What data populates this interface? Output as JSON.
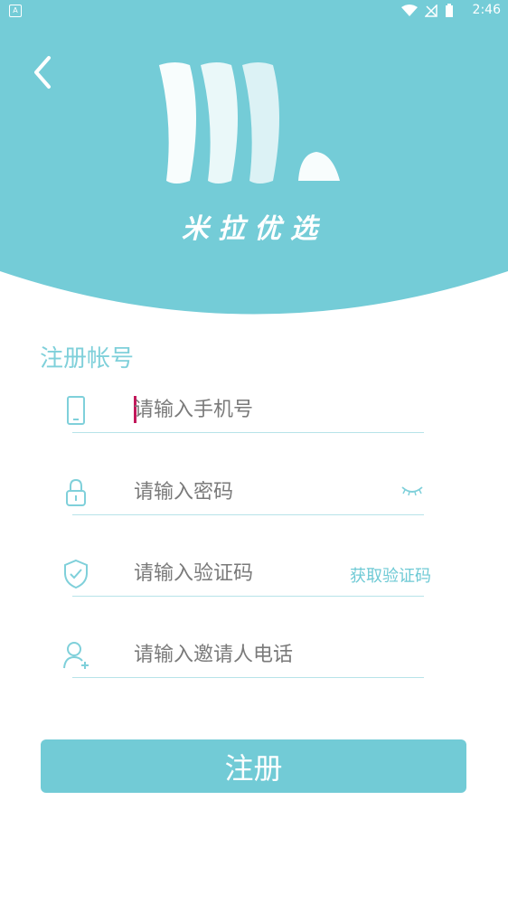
{
  "status_bar": {
    "time": "2:46",
    "notification_badge": "A"
  },
  "header": {
    "brand_name": "米拉优选"
  },
  "form": {
    "title": "注册帐号",
    "phone_placeholder": "请输入手机号",
    "password_placeholder": "请输入密码",
    "code_placeholder": "请输入验证码",
    "get_code_label": "获取验证码",
    "inviter_placeholder": "请输入邀请人电话",
    "submit_label": "注册"
  },
  "colors": {
    "brand": "#72cbd6",
    "accent_text": "#7fd0da",
    "cursor": "#c2185b"
  }
}
